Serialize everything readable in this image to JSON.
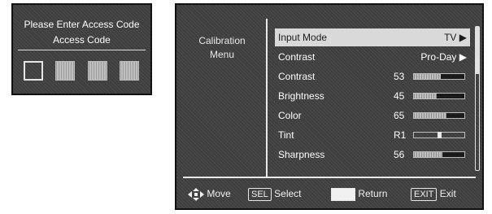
{
  "access": {
    "line1": "Please Enter Access Code",
    "line2": "Access Code",
    "boxes": [
      "empty",
      "filled",
      "filled",
      "filled"
    ]
  },
  "calibration": {
    "side_title_1": "Calibration",
    "side_title_2": "Menu",
    "rows": [
      {
        "label": "Input Mode",
        "value": "TV ▶"
      },
      {
        "label": "Contrast",
        "value": "Pro-Day ▶"
      },
      {
        "label": "Contrast",
        "number": "53",
        "level": 0.53
      },
      {
        "label": "Brightness",
        "number": "45",
        "level": 0.45
      },
      {
        "label": "Color",
        "number": "65",
        "level": 0.65
      },
      {
        "label": "Tint",
        "number": "R1",
        "level": 0.51
      },
      {
        "label": "Sharpness",
        "number": "56",
        "level": 0.56
      }
    ],
    "footer": {
      "move": "Move",
      "sel_key": "SEL",
      "select": "Select",
      "return": "Return",
      "exit_key": "EXIT",
      "exit": "Exit"
    }
  },
  "colors": {
    "panel_bg": "#3e3e3e",
    "highlight": "#d9d9d9",
    "text": "#ffffff"
  }
}
